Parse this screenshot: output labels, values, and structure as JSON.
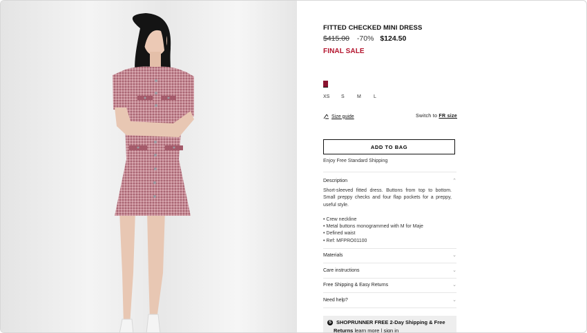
{
  "product": {
    "title": "FITTED CHECKED MINI DRESS",
    "original_price": "$415.00",
    "discount": "-70%",
    "final_price": "$124.50",
    "final_sale_label": "FINAL SALE",
    "selected_color": "#8a1430"
  },
  "sizes": [
    "XS",
    "S",
    "M",
    "L"
  ],
  "size_guide": {
    "label": "Size guide",
    "switch_prefix": "Switch to",
    "switch_link": "FR size"
  },
  "actions": {
    "add_to_bag": "ADD TO BAG",
    "shipping_note": "Enjoy Free Standard Shipping"
  },
  "description": {
    "heading": "Description",
    "text": "Short-sleeved fitted dress. Buttons from top to bottom. Small preppy checks and four flap pockets for a preppy, useful style.",
    "bullets": [
      "• Crew neckline",
      "• Metal buttons monogrammed with M for Maje",
      "• Defined waist",
      "• Ref: MFPRO01100"
    ]
  },
  "accordion": [
    {
      "label": "Materials"
    },
    {
      "label": "Care instructions"
    },
    {
      "label": "Free Shipping & Easy Returns"
    },
    {
      "label": "Need help?"
    }
  ],
  "shoprunner": {
    "headline": "SHOPRUNNER FREE 2-Day Shipping & Free",
    "returns": "Returns",
    "learn_more": "learn more",
    "separator": "|",
    "sign_in": "sign in"
  }
}
